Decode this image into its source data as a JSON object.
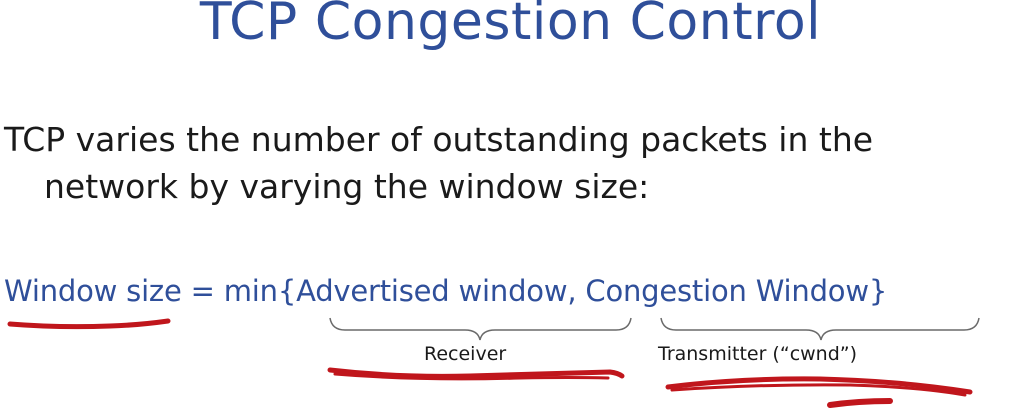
{
  "slide": {
    "title": "TCP Congestion Control",
    "body_line1": "TCP varies the number of outstanding packets in the",
    "body_line2": "network by varying the window size:",
    "formula": "Window size = min{Advertised window, Congestion Window}",
    "receiver_label": "Receiver",
    "transmitter_label": "Transmitter (“cwnd”)"
  },
  "colors": {
    "title": "#2f4f9a",
    "formula": "#2f4f9a",
    "body": "#1a1a1a",
    "annotation": "#c0161c"
  }
}
